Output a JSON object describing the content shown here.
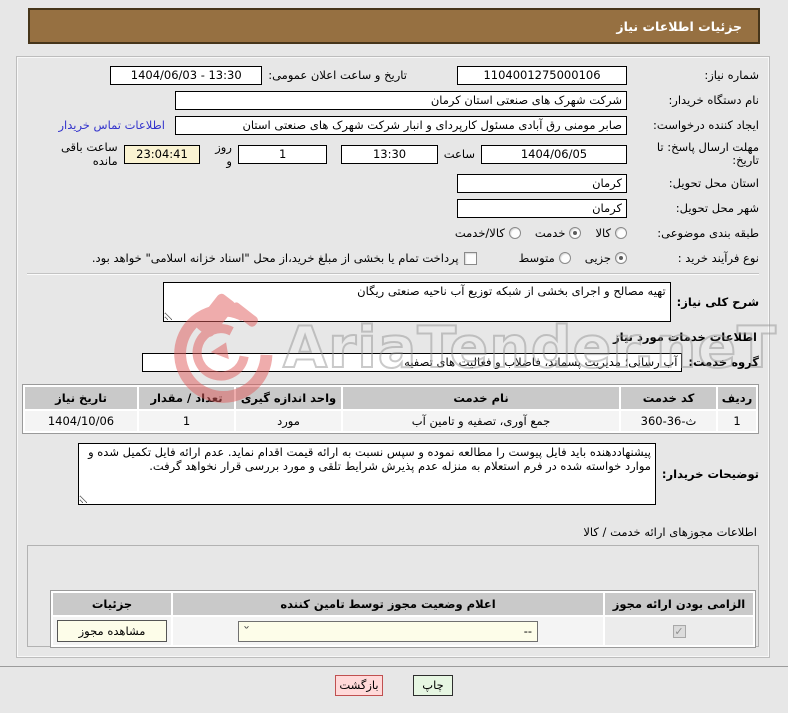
{
  "title_bar": "جزئیات اطلاعات نیاز",
  "watermark": {
    "text": "AriaTender.neT"
  },
  "form": {
    "need_number": {
      "label": "شماره نیاز:",
      "value": "1104001275000106"
    },
    "announce": {
      "label": "تاریخ و ساعت اعلان عمومی:",
      "value": "1404/06/03 - 13:30"
    },
    "buyer_org": {
      "label": "نام دستگاه خریدار:",
      "value": "شرکت شهرک های صنعتی استان کرمان"
    },
    "creator": {
      "label": "ایجاد کننده درخواست:",
      "value": "صابر مومنی رق آبادی مسئول کارپردای و انبار شرکت شهرک های صنعتی استان",
      "link": "اطلاعات تماس خریدار"
    },
    "deadline": {
      "label": "مهلت ارسال پاسخ: تا تاریخ:",
      "date": "1404/06/05",
      "time_label": "ساعت",
      "time": "13:30",
      "days": "1",
      "days_label": "روز و",
      "countdown": "23:04:41",
      "countdown_label": "ساعت باقی مانده"
    },
    "province": {
      "label": "استان محل تحویل:",
      "value": "کرمان"
    },
    "city": {
      "label": "شهر محل تحویل:",
      "value": "کرمان"
    },
    "subject": {
      "label": "طبقه بندی موضوعی:",
      "options": [
        {
          "label": "کالا",
          "selected": false
        },
        {
          "label": "خدمت",
          "selected": true
        },
        {
          "label": "کالا/خدمت",
          "selected": false
        }
      ]
    },
    "process": {
      "label": "نوع فرآیند خرید :",
      "options": [
        {
          "label": "جزیی",
          "selected": true
        },
        {
          "label": "متوسط",
          "selected": false
        }
      ],
      "treasury": "پرداخت تمام یا بخشی از مبلغ خرید،از محل \"اسناد خزانه اسلامی\" خواهد بود."
    }
  },
  "need_desc": {
    "label": "شرح کلی نیاز:",
    "value": "تهیه مصالح و اجرای بخشی از شبکه توزیع آب ناحیه صنعتی ریگان"
  },
  "services": {
    "heading": "اطلاعات خدمات مورد نیاز",
    "group": {
      "label": "گروه خدمت:",
      "value": "آب رسانی؛ مدیریت پسماند، فاضلاب و فعالیت های تصفیه"
    },
    "table": {
      "headers": [
        "ردیف",
        "کد خدمت",
        "نام خدمت",
        "واحد اندازه گیری",
        "تعداد / مقدار",
        "تاریخ نیاز"
      ],
      "rows": [
        [
          "1",
          "ث-36-360",
          "جمع آوری، تصفیه و تامین آب",
          "مورد",
          "1",
          "1404/10/06"
        ]
      ]
    }
  },
  "notes": {
    "label": "توضیحات خریدار:",
    "value": "پیشنهاددهنده باید فایل پیوست را مطالعه نموده و سپس نسبت به ارائه قیمت اقدام نماید. عدم ارائه فایل تکمیل شده و موارد خواسته شده در فرم استعلام به منزله عدم پذیرش شرایط تلقی و مورد بررسی قرار نخواهد گرفت."
  },
  "licenses": {
    "heading": "اطلاعات مجوزهای ارائه خدمت / کالا",
    "table": {
      "headers": [
        "الزامی بودن ارائه مجوز",
        "اعلام وضعیت مجوز توسط تامین کننده",
        "جزئیات"
      ],
      "required_checked": true,
      "status_value": "--",
      "details_button": "مشاهده مجوز"
    }
  },
  "footer": {
    "print": "چاپ",
    "back": "بازگشت"
  }
}
